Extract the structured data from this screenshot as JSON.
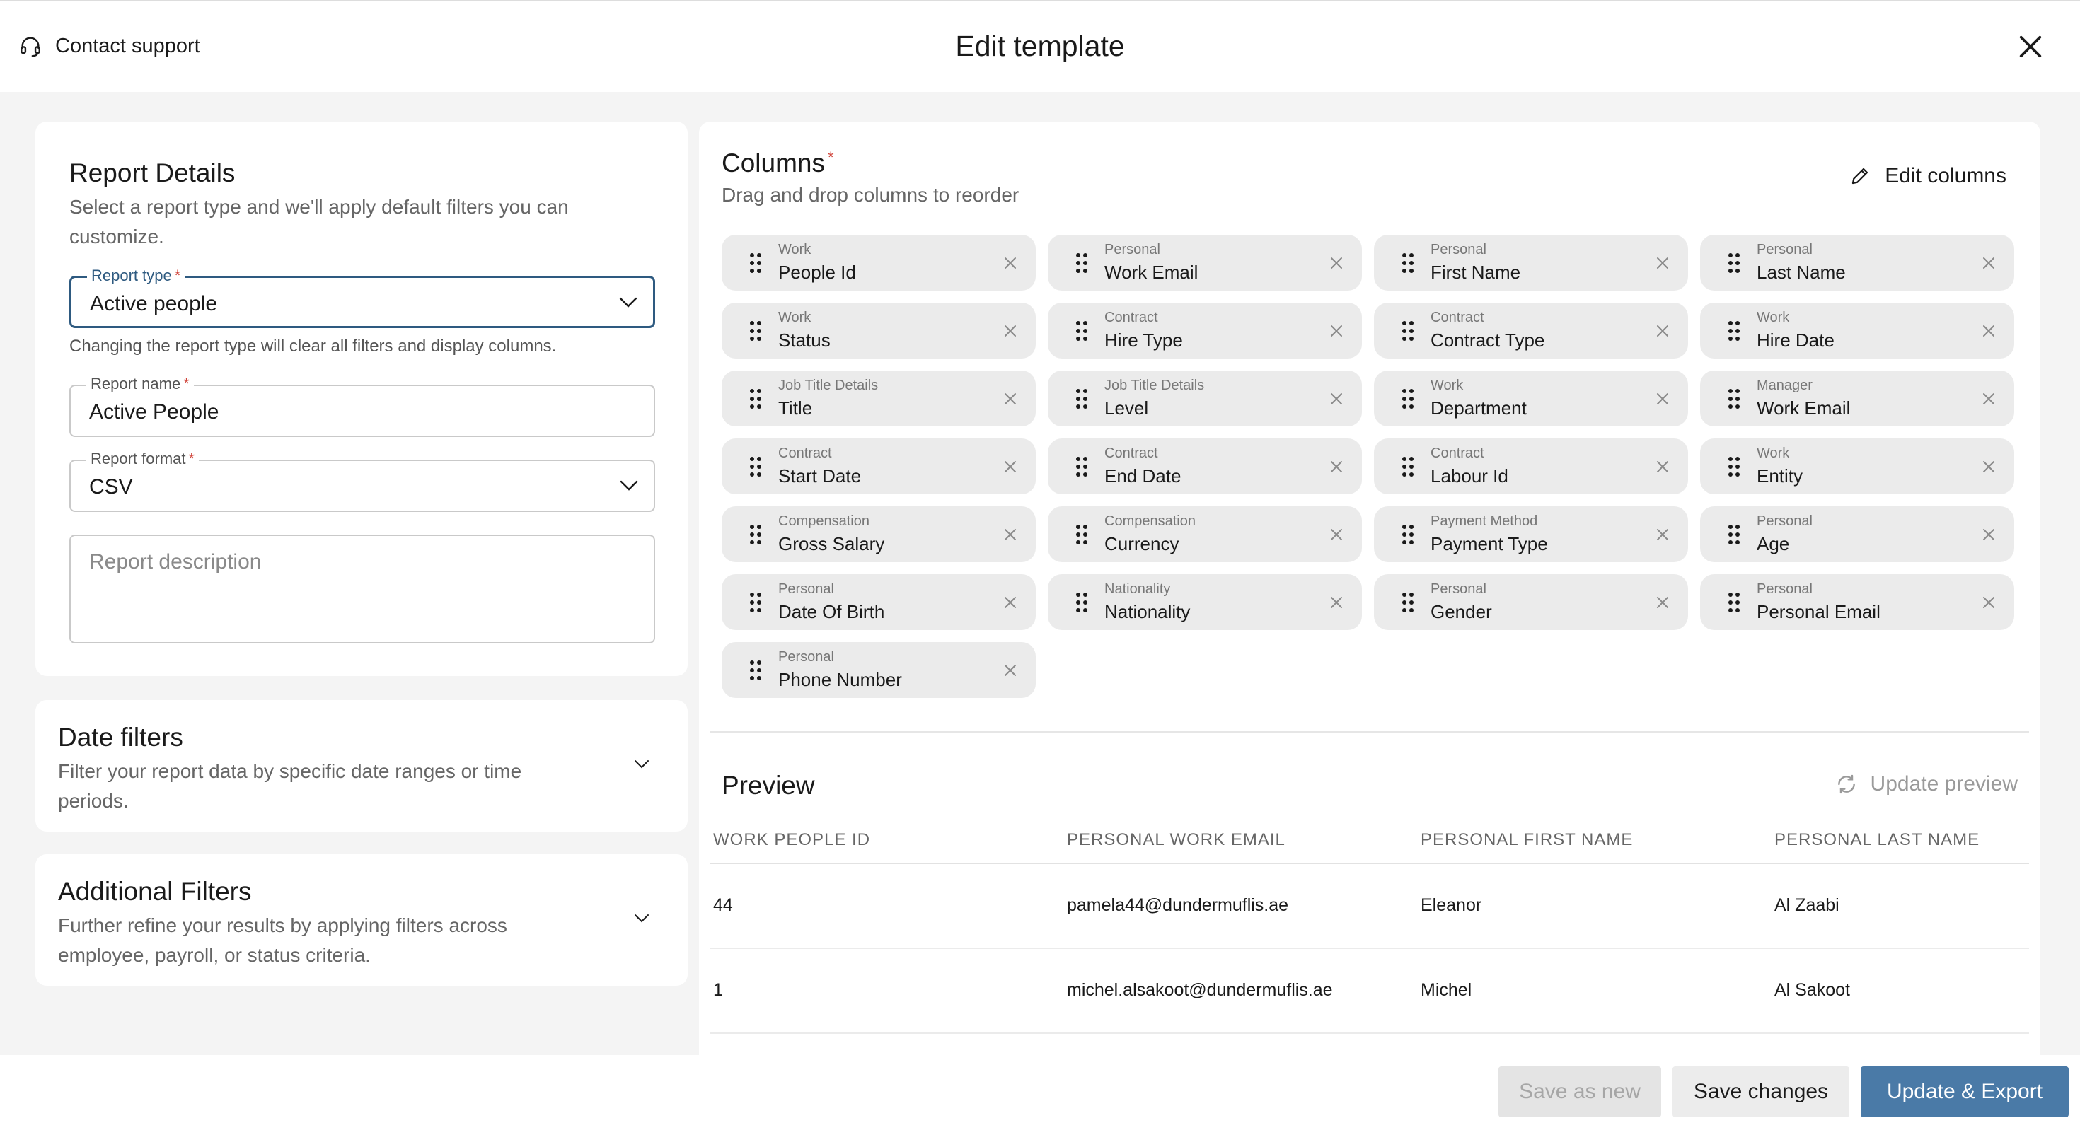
{
  "header": {
    "support_label": "Contact support",
    "title": "Edit template"
  },
  "report_details": {
    "heading": "Report Details",
    "subtitle": "Select a report type and we'll apply default filters you can customize.",
    "report_type": {
      "label": "Report type",
      "value": "Active people"
    },
    "helper": "Changing the report type will clear all filters and display columns.",
    "report_name": {
      "label": "Report name",
      "value": "Active People"
    },
    "report_format": {
      "label": "Report format",
      "value": "CSV"
    },
    "description": {
      "placeholder": "Report description"
    }
  },
  "date_filters": {
    "heading": "Date filters",
    "subtitle": "Filter your report data by specific date ranges or time periods."
  },
  "additional_filters": {
    "heading": "Additional Filters",
    "subtitle": "Further refine your results by applying filters across employee, payroll, or status criteria."
  },
  "columns": {
    "heading": "Columns",
    "subtitle": "Drag and drop columns to reorder",
    "edit_label": "Edit columns",
    "items": [
      {
        "category": "Work",
        "name": "People Id"
      },
      {
        "category": "Personal",
        "name": "Work Email"
      },
      {
        "category": "Personal",
        "name": "First Name"
      },
      {
        "category": "Personal",
        "name": "Last Name"
      },
      {
        "category": "Work",
        "name": "Status"
      },
      {
        "category": "Contract",
        "name": "Hire Type"
      },
      {
        "category": "Contract",
        "name": "Contract Type"
      },
      {
        "category": "Work",
        "name": "Hire Date"
      },
      {
        "category": "Job Title Details",
        "name": "Title"
      },
      {
        "category": "Job Title Details",
        "name": "Level"
      },
      {
        "category": "Work",
        "name": "Department"
      },
      {
        "category": "Manager",
        "name": "Work Email"
      },
      {
        "category": "Contract",
        "name": "Start Date"
      },
      {
        "category": "Contract",
        "name": "End Date"
      },
      {
        "category": "Contract",
        "name": "Labour Id"
      },
      {
        "category": "Work",
        "name": "Entity"
      },
      {
        "category": "Compensation",
        "name": "Gross Salary"
      },
      {
        "category": "Compensation",
        "name": "Currency"
      },
      {
        "category": "Payment Method",
        "name": "Payment Type"
      },
      {
        "category": "Personal",
        "name": "Age"
      },
      {
        "category": "Personal",
        "name": "Date Of Birth"
      },
      {
        "category": "Nationality",
        "name": "Nationality"
      },
      {
        "category": "Personal",
        "name": "Gender"
      },
      {
        "category": "Personal",
        "name": "Personal Email"
      },
      {
        "category": "Personal",
        "name": "Phone Number"
      }
    ]
  },
  "preview": {
    "heading": "Preview",
    "update_label": "Update preview",
    "headers": [
      "WORK PEOPLE ID",
      "PERSONAL WORK EMAIL",
      "PERSONAL FIRST NAME",
      "PERSONAL LAST NAME"
    ],
    "rows": [
      [
        "44",
        "pamela44@dundermuflis.ae",
        "Eleanor",
        "Al Zaabi"
      ],
      [
        "1",
        "michel.alsakoot@dundermuflis.ae",
        "Michel",
        "Al Sakoot"
      ]
    ]
  },
  "footer": {
    "save_as_new": "Save as new",
    "save_changes": "Save changes",
    "update_export": "Update & Export"
  },
  "colors": {
    "accent": "#2e5a80",
    "primary_button": "#4a7aa7",
    "required": "#d0453b"
  }
}
